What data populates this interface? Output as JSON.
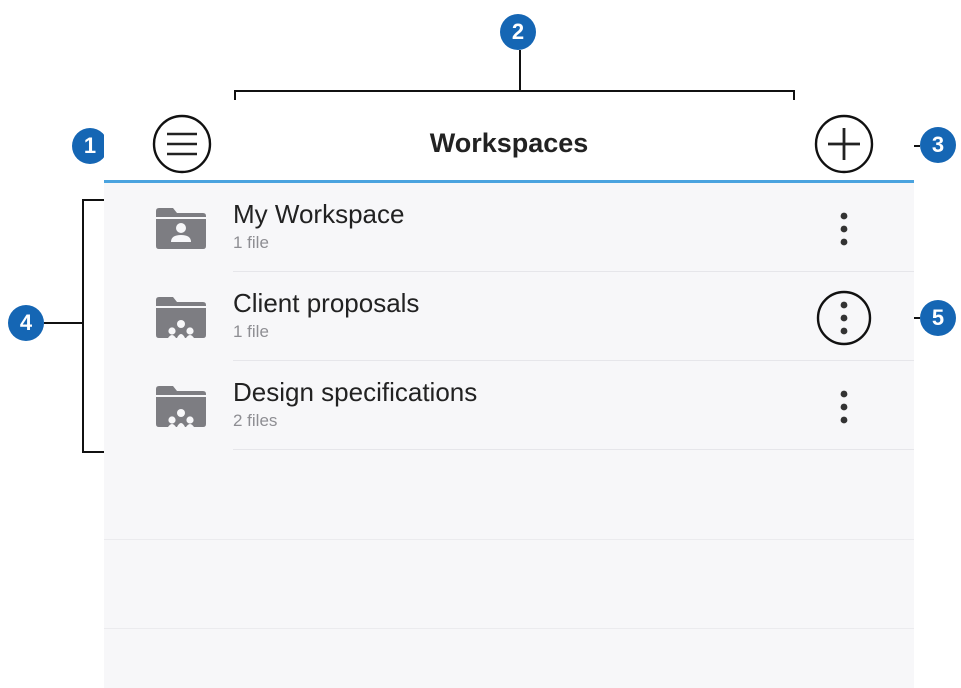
{
  "header": {
    "title": "Workspaces",
    "menu_icon": "hamburger-menu-icon",
    "add_icon": "plus-circle-icon"
  },
  "workspaces": [
    {
      "name": "My Workspace",
      "meta": "1 file",
      "icon": "personal-folder-icon"
    },
    {
      "name": "Client proposals",
      "meta": "1 file",
      "icon": "shared-folder-icon"
    },
    {
      "name": "Design specifications",
      "meta": "2 files",
      "icon": "shared-folder-icon"
    }
  ],
  "callouts": [
    "1",
    "2",
    "3",
    "4",
    "5"
  ],
  "colors": {
    "accent_line": "#4aa3df",
    "badge": "#1566b4",
    "folder": "#7d7d82",
    "list_bg": "#f7f7f9"
  }
}
